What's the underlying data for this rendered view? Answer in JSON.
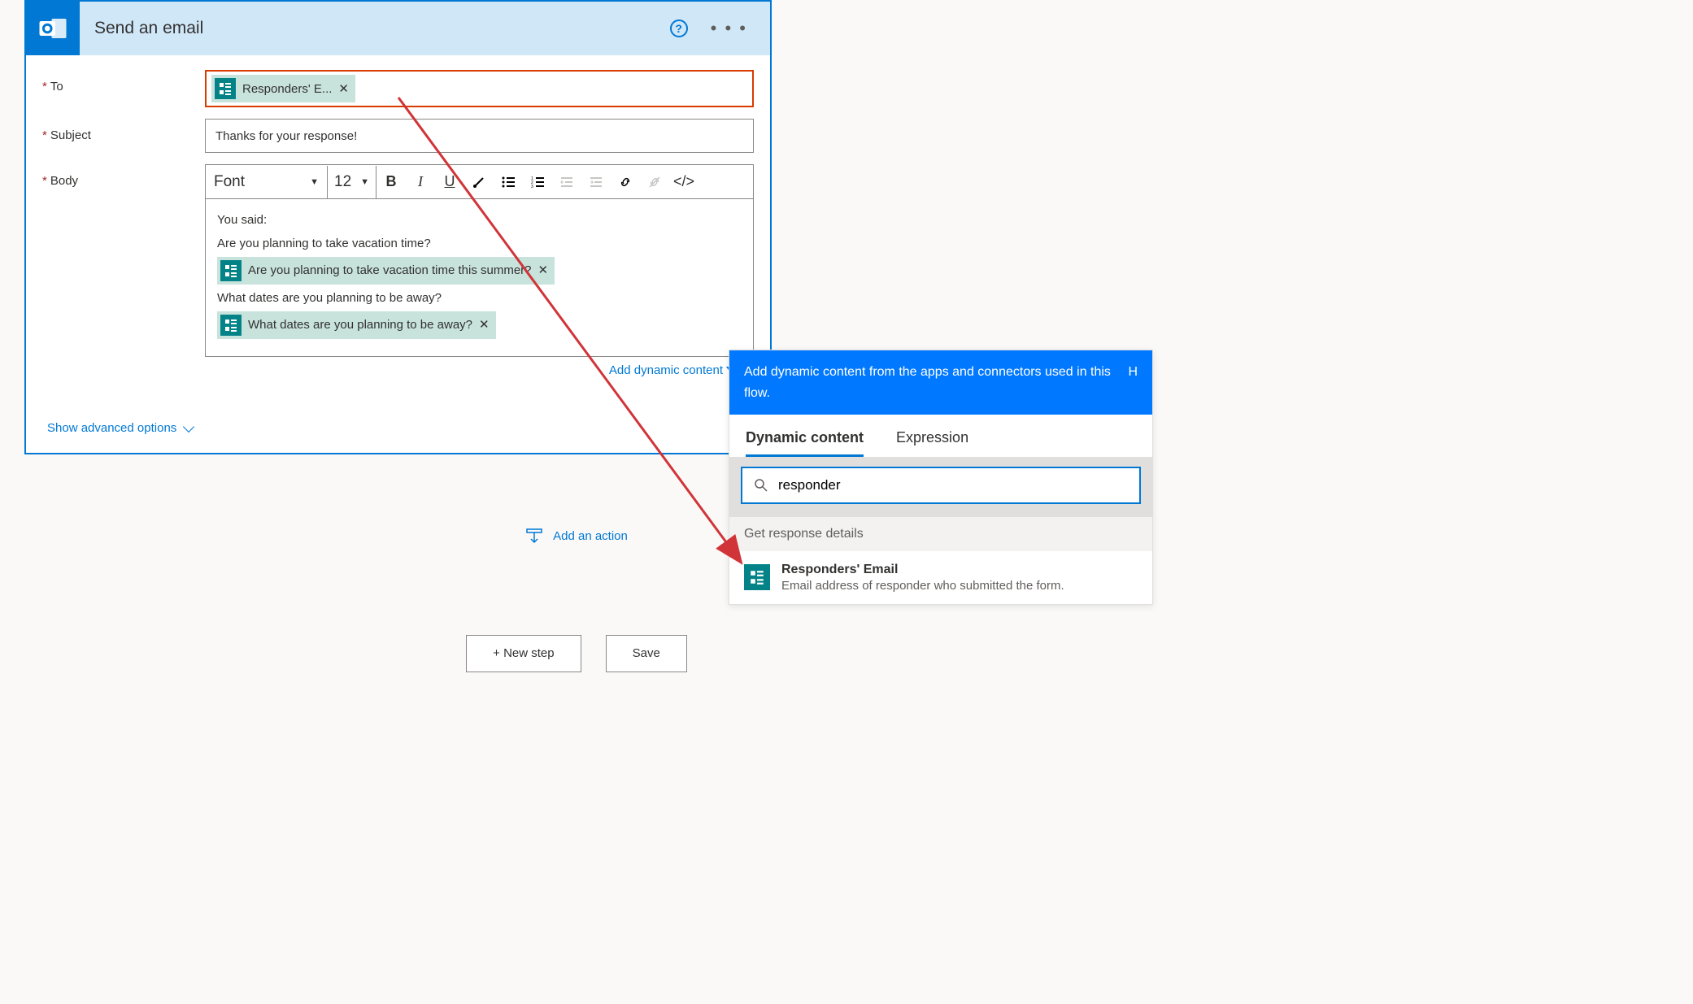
{
  "card": {
    "title": "Send an email",
    "help_tooltip": "?",
    "menu": "• • •"
  },
  "labels": {
    "to": "To",
    "subject": "Subject",
    "body": "Body"
  },
  "to_token": {
    "label": "Responders' E...",
    "close": "✕"
  },
  "subject_value": "Thanks for your response!",
  "rte": {
    "font": "Font",
    "size": "12"
  },
  "body": {
    "line1": "You said:",
    "line2": "Are you planning to take vacation time?",
    "token1": "Are you planning to take vacation time this summer?",
    "line3": "What dates are you planning to be away?",
    "token2": "What dates are you planning to be away?"
  },
  "links": {
    "add_dynamic": "Add dynamic content",
    "advanced": "Show advanced options",
    "add_action": "Add an action"
  },
  "buttons": {
    "new_step": "+ New step",
    "save": "Save"
  },
  "dc": {
    "hero": "Add dynamic content from the apps and connectors used in this flow.",
    "hide": "H",
    "tab_dynamic": "Dynamic content",
    "tab_expr": "Expression",
    "search_value": "responder",
    "section": "Get response details",
    "item_title": "Responders' Email",
    "item_desc": "Email address of responder who submitted the form."
  }
}
